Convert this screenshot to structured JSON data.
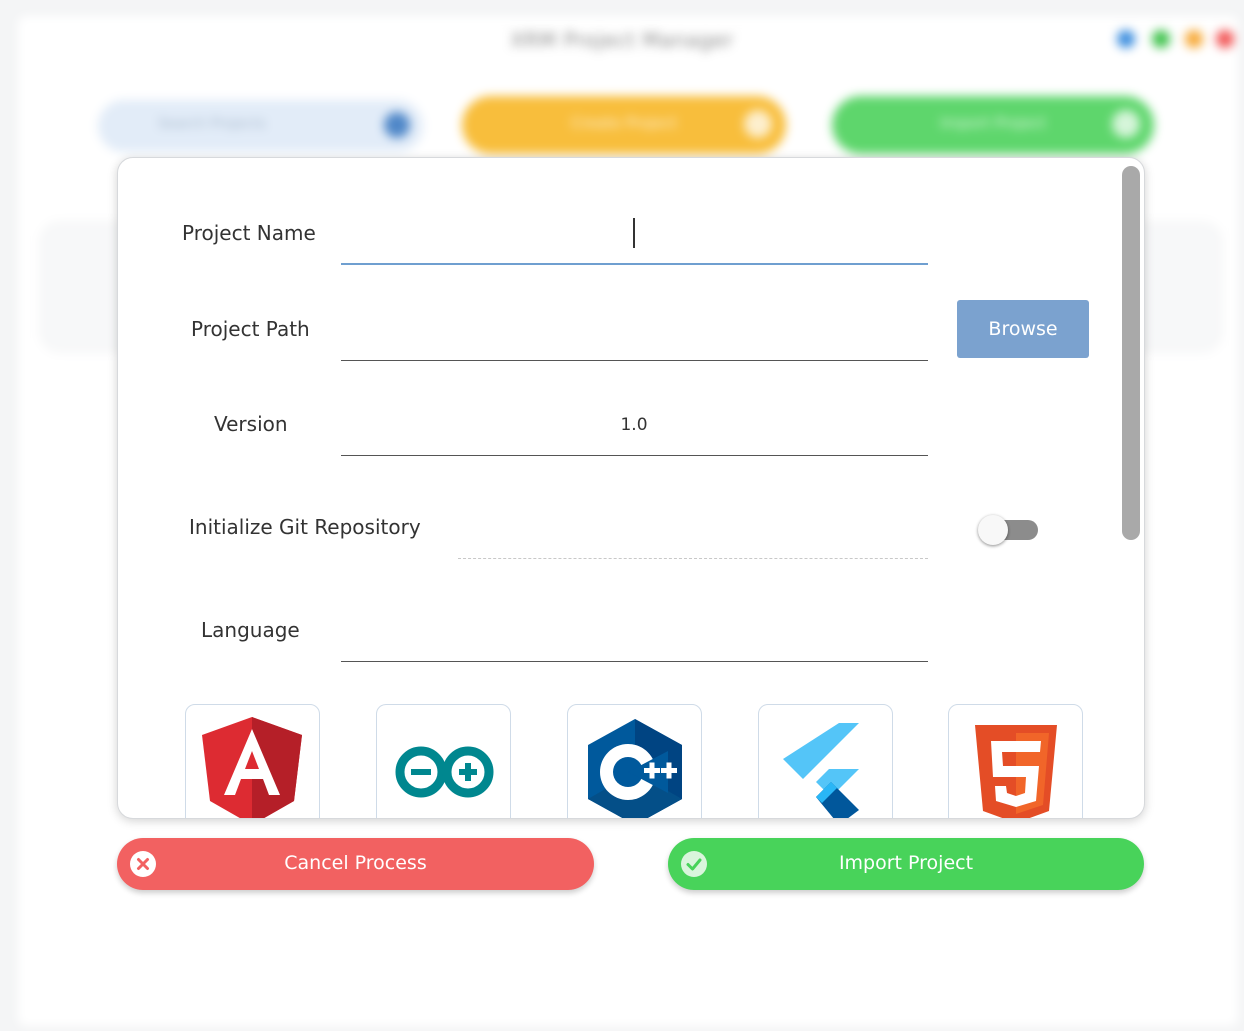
{
  "background": {
    "window_title": "XRM Project Manager",
    "search_placeholder": "Search Projects",
    "create_button_label": "Create Project",
    "import_button_label": "Import Project",
    "colors": {
      "search_bg": "#e2ecf8",
      "create": "#f8be3c",
      "import": "#5ed66c",
      "window_controls": [
        "#3a8dde",
        "#3ec24b",
        "#f7a937",
        "#f25555"
      ]
    }
  },
  "form": {
    "project_name": {
      "label": "Project Name",
      "value": ""
    },
    "project_path": {
      "label": "Project Path",
      "value": ""
    },
    "browse_label": "Browse",
    "version": {
      "label": "Version",
      "value": "1.0"
    },
    "git": {
      "label": "Initialize Git Repository",
      "enabled": false
    },
    "language": {
      "label": "Language",
      "value": ""
    },
    "languages": [
      {
        "icon": "angular-icon"
      },
      {
        "icon": "arduino-icon"
      },
      {
        "icon": "cplusplus-icon"
      },
      {
        "icon": "flutter-icon"
      },
      {
        "icon": "html5-icon"
      }
    ]
  },
  "actions": {
    "cancel_label": "Cancel Process",
    "cancel_icon": "close-icon",
    "cancel_color": "#f26161",
    "import_label": "Import Project",
    "import_icon": "check-icon",
    "import_color": "#48d35a"
  }
}
